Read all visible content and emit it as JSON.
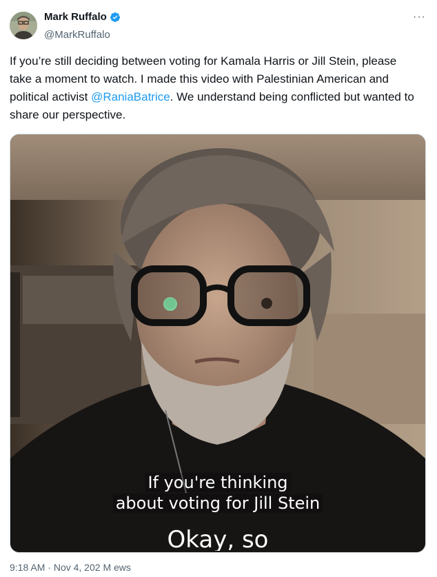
{
  "author": {
    "display_name": "Mark Ruffalo",
    "handle": "@MarkRuffalo",
    "verified": true
  },
  "more_icon": "···",
  "tweet": {
    "text_part1": "If you’re still deciding between voting for Kamala Harris or Jill Stein, please take a moment to watch. I made this video with Palestinian American and political activist ",
    "mention": "@RaniaBatrice",
    "text_part2": ". We understand being conflicted but wanted to share our perspective."
  },
  "video": {
    "caption_line1": "If you're thinking",
    "caption_line2": "about voting for Jill Stein",
    "caption_next": "Okay, so"
  },
  "meta": {
    "time": "9:18 AM",
    "separator": "·",
    "date": "Nov 4, 202",
    "views": "M  ews"
  },
  "colors": {
    "accent": "#1d9bf0",
    "secondary_text": "#536471"
  }
}
